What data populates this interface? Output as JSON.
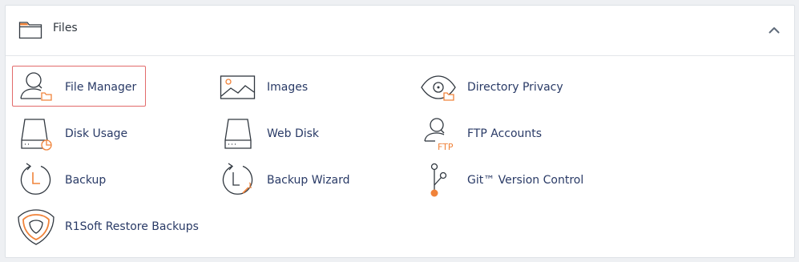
{
  "section": {
    "title": "Files",
    "icon": "folder-icon",
    "collapse_icon": "chevron-up-icon"
  },
  "colors": {
    "accent": "#f0833a",
    "link": "#293a66",
    "highlight": "#e26b6b"
  },
  "items": [
    {
      "label": "File Manager",
      "icon": "file-manager-icon",
      "selected": true
    },
    {
      "label": "Images",
      "icon": "images-icon"
    },
    {
      "label": "Directory Privacy",
      "icon": "directory-privacy-icon"
    },
    {
      "label": "Disk Usage",
      "icon": "disk-usage-icon"
    },
    {
      "label": "Web Disk",
      "icon": "web-disk-icon"
    },
    {
      "label": "FTP Accounts",
      "icon": "ftp-accounts-icon",
      "badge": "FTP"
    },
    {
      "label": "Backup",
      "icon": "backup-icon"
    },
    {
      "label": "Backup Wizard",
      "icon": "backup-wizard-icon"
    },
    {
      "label": "Git™ Version Control",
      "icon": "git-version-control-icon"
    },
    {
      "label": "R1Soft Restore Backups",
      "icon": "r1soft-restore-icon"
    }
  ]
}
